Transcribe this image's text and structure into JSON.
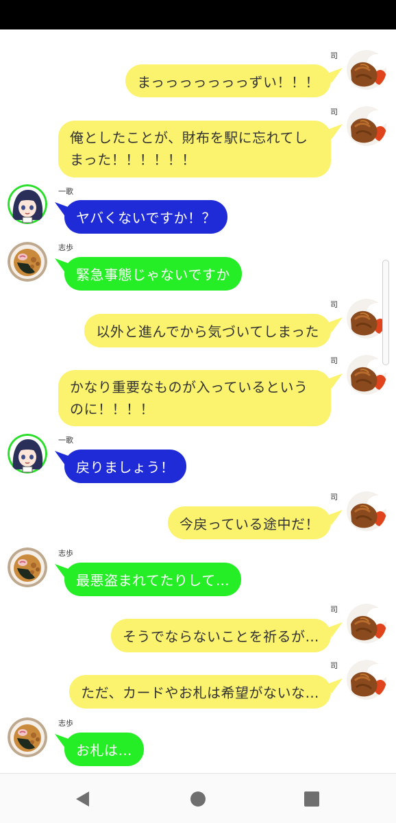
{
  "messages": [
    {
      "sender": "司",
      "side": "right",
      "avatar": "food-icon",
      "text": "まっっっっっっっずい！！！"
    },
    {
      "sender": "司",
      "side": "right",
      "avatar": "food-icon",
      "text": "俺としたことが、財布を駅に忘れてしまった！！！！！！"
    },
    {
      "sender": "一歌",
      "side": "left",
      "color": "blue",
      "avatar": "anime-girl-icon",
      "text": "ヤバくないですか！？"
    },
    {
      "sender": "志歩",
      "side": "left",
      "color": "green",
      "avatar": "ramen-icon",
      "text": "緊急事態じゃないですか"
    },
    {
      "sender": "司",
      "side": "right",
      "avatar": "food-icon",
      "text": "以外と進んでから気づいてしまった"
    },
    {
      "sender": "司",
      "side": "right",
      "avatar": "food-icon",
      "text": "かなり重要なものが入っているというのに！！！！"
    },
    {
      "sender": "一歌",
      "side": "left",
      "color": "blue",
      "avatar": "anime-girl-icon",
      "text": "戻りましょう！"
    },
    {
      "sender": "司",
      "side": "right",
      "avatar": "food-icon",
      "text": "今戻っている途中だ！"
    },
    {
      "sender": "志歩",
      "side": "left",
      "color": "green",
      "avatar": "ramen-icon",
      "text": "最悪盗まれてたりして…"
    },
    {
      "sender": "司",
      "side": "right",
      "avatar": "food-icon",
      "text": "そうでならないことを祈るが…"
    },
    {
      "sender": "司",
      "side": "right",
      "avatar": "food-icon",
      "text": "ただ、カードやお札は希望がないな…"
    },
    {
      "sender": "志歩",
      "side": "left",
      "color": "green",
      "avatar": "ramen-icon",
      "text": "お札は…"
    }
  ],
  "colors": {
    "yellow_bubble": "#fbf36d",
    "blue_bubble": "#1e2bd6",
    "green_bubble": "#26ee26",
    "avatar_ring": "#2adf2a"
  },
  "nav": {
    "back_icon": "back-triangle-icon",
    "home_icon": "home-circle-icon",
    "recent_icon": "recent-square-icon"
  }
}
